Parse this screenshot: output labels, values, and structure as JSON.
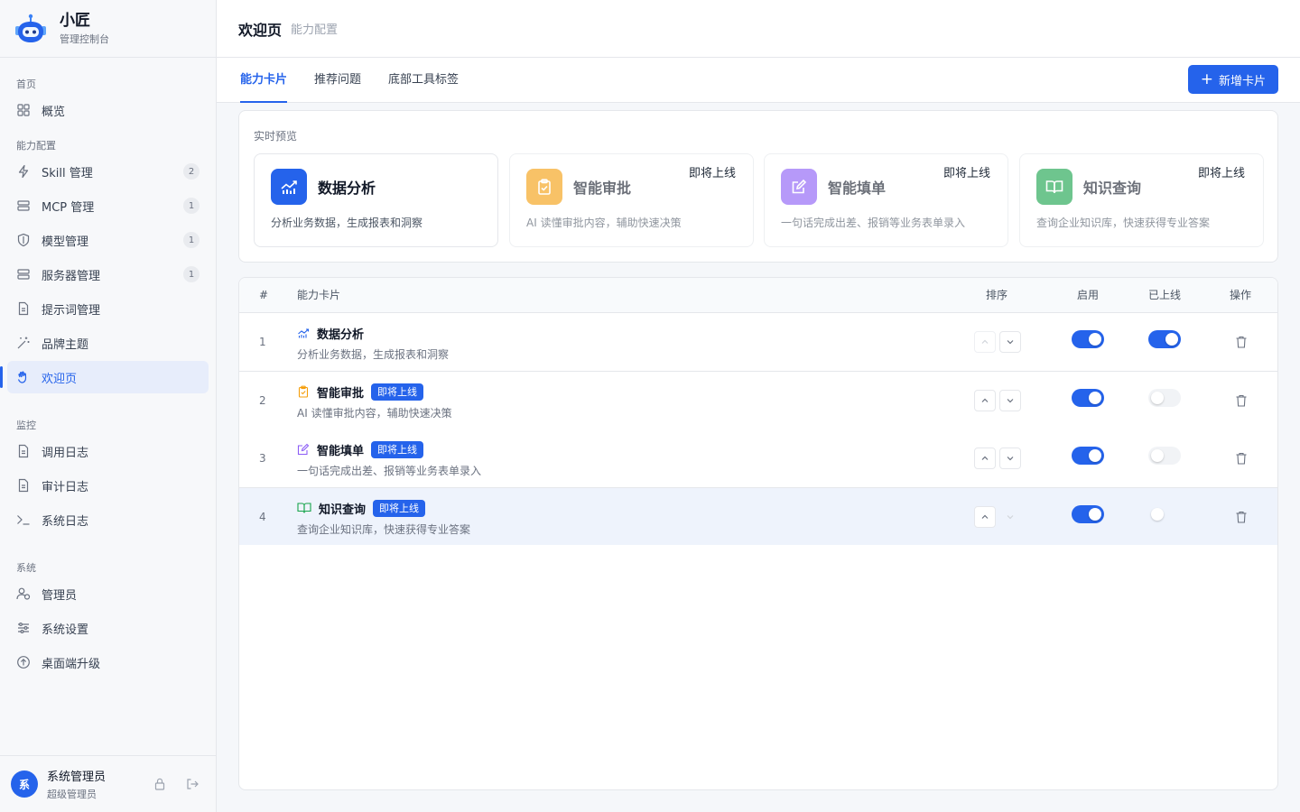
{
  "brand": {
    "name": "小匠",
    "subtitle": "管理控制台"
  },
  "nav": {
    "sections": {
      "home": "首页",
      "capability": "能力配置",
      "monitor": "监控",
      "system": "系统"
    },
    "items": {
      "overview": {
        "label": "概览",
        "icon": "grid-icon"
      },
      "skill": {
        "label": "Skill 管理",
        "count": "2",
        "icon": "lightning-icon"
      },
      "mcp": {
        "label": "MCP 管理",
        "count": "1",
        "icon": "server-icon"
      },
      "model": {
        "label": "模型管理",
        "count": "1",
        "icon": "shield-icon"
      },
      "server": {
        "label": "服务器管理",
        "count": "1",
        "icon": "server-icon"
      },
      "prompt": {
        "label": "提示词管理",
        "icon": "document-icon"
      },
      "brand": {
        "label": "品牌主题",
        "icon": "magic-wand-icon"
      },
      "welcome": {
        "label": "欢迎页",
        "icon": "wave-hand-icon"
      },
      "call_log": {
        "label": "调用日志",
        "icon": "document-icon"
      },
      "audit_log": {
        "label": "审计日志",
        "icon": "document-icon"
      },
      "sys_log": {
        "label": "系统日志",
        "icon": "terminal-icon"
      },
      "admin": {
        "label": "管理员",
        "icon": "users-icon"
      },
      "settings": {
        "label": "系统设置",
        "icon": "sliders-icon"
      },
      "upgrade": {
        "label": "桌面端升级",
        "icon": "arrow-up-circle-icon"
      }
    }
  },
  "user": {
    "avatar": "系",
    "name": "系统管理员",
    "role": "超级管理员"
  },
  "header": {
    "title": "欢迎页",
    "crumb": "能力配置"
  },
  "tabs": {
    "cards": "能力卡片",
    "questions": "推荐问题",
    "toolbar": "底部工具标签"
  },
  "add_button": "新增卡片",
  "preview": {
    "label": "实时预览",
    "cards": [
      {
        "title": "数据分析",
        "desc": "分析业务数据，生成报表和洞察",
        "color": "#2563eb",
        "badge": ""
      },
      {
        "title": "智能审批",
        "desc": "AI 读懂审批内容，辅助快速决策",
        "color": "#f59e0b",
        "badge": "即将上线"
      },
      {
        "title": "智能填单",
        "desc": "一句话完成出差、报销等业务表单录入",
        "color": "#8b5cf6",
        "badge": "即将上线"
      },
      {
        "title": "知识查询",
        "desc": "查询企业知识库，快速获得专业答案",
        "color": "#16a34a",
        "badge": "即将上线"
      }
    ]
  },
  "table": {
    "headers": {
      "idx": "#",
      "card": "能力卡片",
      "sort": "排序",
      "enabled": "启用",
      "online": "已上线",
      "action": "操作"
    },
    "rows": [
      {
        "idx": "1",
        "title": "数据分析",
        "desc": "分析业务数据，生成报表和洞察",
        "badge": "",
        "enabled": true,
        "online": true
      },
      {
        "idx": "2",
        "title": "智能审批",
        "desc": "AI 读懂审批内容，辅助快速决策",
        "badge": "即将上线",
        "enabled": true,
        "online": false
      },
      {
        "idx": "3",
        "title": "智能填单",
        "desc": "一句话完成出差、报销等业务表单录入",
        "badge": "即将上线",
        "enabled": true,
        "online": false
      },
      {
        "idx": "4",
        "title": "知识查询",
        "desc": "查询企业知识库，快速获得专业答案",
        "badge": "即将上线",
        "enabled": true,
        "online": false
      }
    ]
  }
}
